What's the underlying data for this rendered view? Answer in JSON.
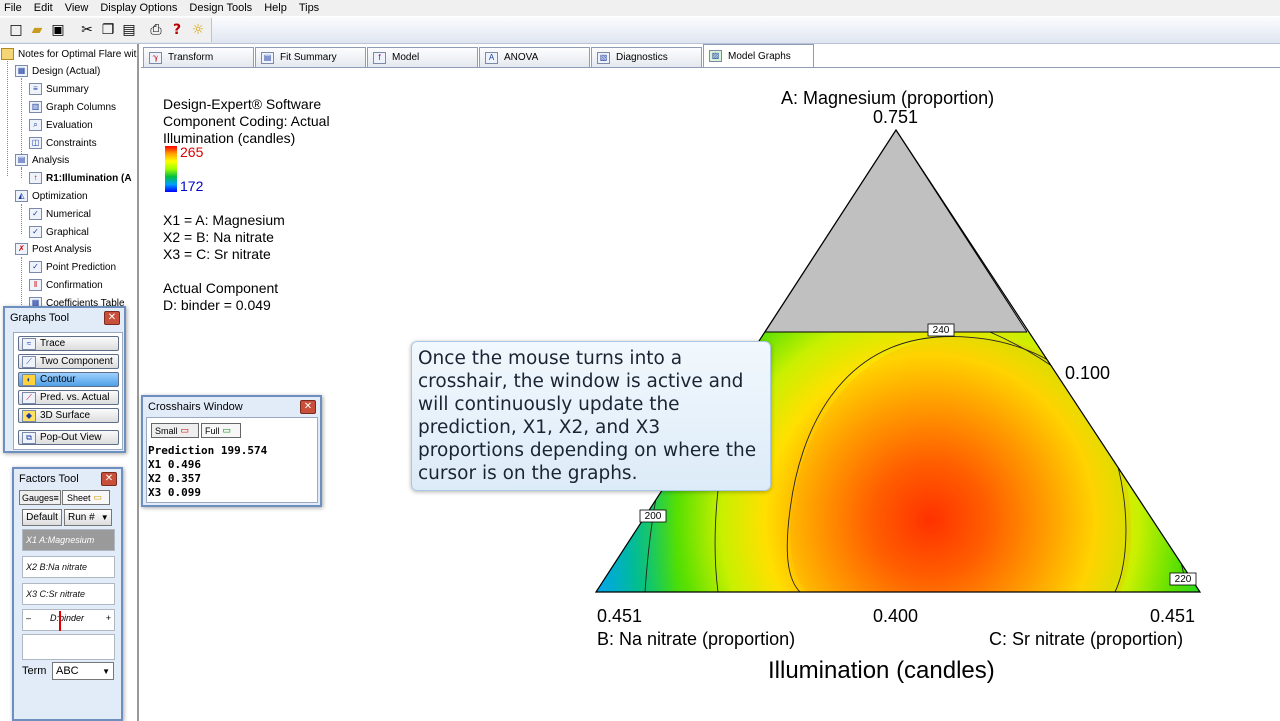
{
  "menu": [
    "File",
    "Edit",
    "View",
    "Display Options",
    "Design Tools",
    "Help",
    "Tips"
  ],
  "toolbar_icons": [
    "new-file-icon",
    "open-folder-icon",
    "save-icon",
    "cut-icon",
    "copy-icon",
    "paste-icon",
    "print-icon",
    "help-icon",
    "tip-bulb-icon"
  ],
  "tree": {
    "root": "Notes for Optimal Flare wit",
    "design": "Design (Actual)",
    "summary": "Summary",
    "graph_columns": "Graph Columns",
    "evaluation": "Evaluation",
    "constraints": "Constraints",
    "analysis": "Analysis",
    "response": "R1:Illumination (A",
    "optimization": "Optimization",
    "numerical": "Numerical",
    "graphical": "Graphical",
    "post_analysis": "Post Analysis",
    "point_prediction": "Point Prediction",
    "confirmation": "Confirmation",
    "coefficients_table": "Coefficients Table"
  },
  "tabs": [
    "Transform",
    "Fit Summary",
    "Model",
    "ANOVA",
    "Diagnostics",
    "Model Graphs"
  ],
  "active_tab": "Model Graphs",
  "info": {
    "software": "Design-Expert® Software",
    "coding": "Component Coding: Actual",
    "response": "Illumination (candles)",
    "legend_high": "265",
    "legend_low": "172",
    "x1": "X1 = A: Magnesium",
    "x2": "X2 = B: Na nitrate",
    "x3": "X3 = C: Sr nitrate",
    "actual_component": "Actual Component",
    "binder": "D: binder = 0.049"
  },
  "plot": {
    "top_title": "A: Magnesium (proportion)",
    "top_value": "0.751",
    "right_value": "0.100",
    "left_bottom_value": "0.451",
    "mid_bottom_value": "0.400",
    "right_bottom_value": "0.451",
    "left_axis_title": "B: Na nitrate (proportion)",
    "right_axis_title": "C: Sr nitrate (proportion)",
    "response_title": "Illumination (candles)",
    "contour_labels": [
      "240",
      "200",
      "220"
    ]
  },
  "callout": "Once the mouse turns into a crosshair, the window is active and will continuously update the prediction, X1, X2, and X3 proportions depending on where the cursor is on the graphs.",
  "graphs_tool": {
    "title": "Graphs Tool",
    "buttons": [
      "Trace",
      "Two Component",
      "Contour",
      "Pred. vs. Actual",
      "3D Surface",
      "Pop-Out View"
    ],
    "active": "Contour"
  },
  "crosshairs": {
    "title": "Crosshairs Window",
    "small_label": "Small",
    "full_label": "Full",
    "prediction": "Prediction 199.574",
    "x1": "X1 0.496",
    "x2": "X2 0.357",
    "x3": "X3 0.099"
  },
  "factors_tool": {
    "title": "Factors Tool",
    "gauges_label": "Gauges",
    "sheet_label": "Sheet",
    "default_label": "Default",
    "run_label": "Run #",
    "factors": [
      "X1 A:Magnesium",
      "X2 B:Na nitrate",
      "X3 C:Sr nitrate"
    ],
    "binder_label": "D:binder",
    "binder_fraction": 0.38,
    "term_label": "Term",
    "term_value": "ABC"
  }
}
